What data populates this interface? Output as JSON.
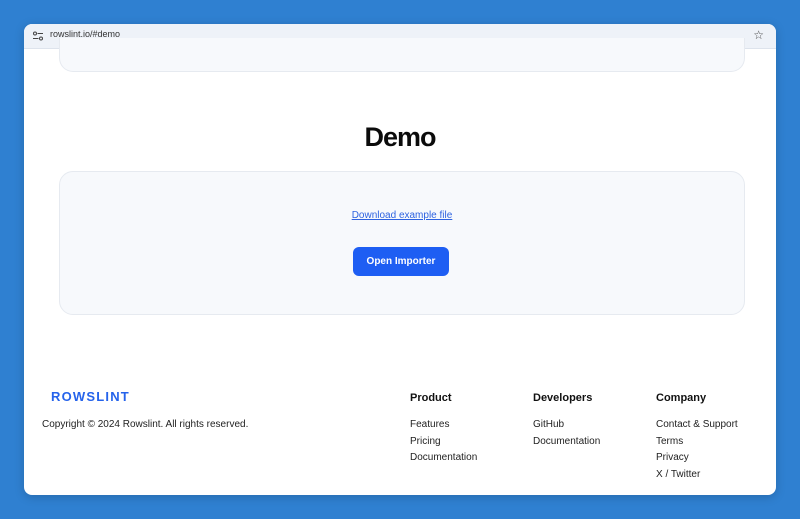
{
  "browser": {
    "url": "rowslint.io/#demo"
  },
  "demo": {
    "heading": "Demo",
    "download_link": "Download example file",
    "open_button": "Open Importer"
  },
  "footer": {
    "logo": "ROWSLINT",
    "copyright": "Copyright © 2024 Rowslint. All rights reserved.",
    "columns": [
      {
        "title": "Product",
        "links": [
          "Features",
          "Pricing",
          "Documentation"
        ]
      },
      {
        "title": "Developers",
        "links": [
          "GitHub",
          "Documentation"
        ]
      },
      {
        "title": "Company",
        "links": [
          "Contact & Support",
          "Terms",
          "Privacy",
          "X / Twitter"
        ]
      }
    ]
  },
  "colors": {
    "background": "#2f80d1",
    "accent": "#1e5ef3",
    "logo": "#2563eb",
    "link": "#2d62e0"
  }
}
